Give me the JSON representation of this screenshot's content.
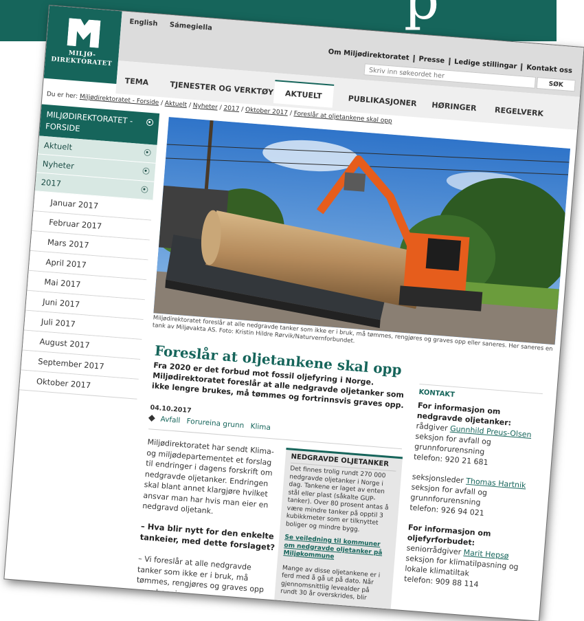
{
  "logo": {
    "line1": "MILJØ-",
    "line2": "DIREKTORATET"
  },
  "lang": {
    "english": "English",
    "sami": "Sámegiella"
  },
  "toplinks": [
    "Om Miljødirektoratet",
    "Presse",
    "Ledige stillingar",
    "Kontakt oss"
  ],
  "search": {
    "placeholder": "Skriv inn søkeordet her",
    "button": "SØK"
  },
  "nav": [
    "TEMA",
    "TJENESTER OG VERKTØY",
    "AKTUELT",
    "PUBLIKASJONER",
    "HØRINGER",
    "REGELVERK"
  ],
  "breadcrumb": {
    "prefix": "Du er her:",
    "items": [
      "Miljødirektoratet - Forside",
      "Aktuelt",
      "Nyheter",
      "2017",
      "Oktober 2017",
      "Foreslår at oljetankene skal opp"
    ]
  },
  "sidebar": {
    "home": "MILJØDIREKTORATET - FORSIDE",
    "sections": [
      "Aktuelt",
      "Nyheter",
      "2017"
    ],
    "months": [
      "Januar 2017",
      "Februar 2017",
      "Mars 2017",
      "April 2017",
      "Mai 2017",
      "Juni 2017",
      "Juli 2017",
      "August 2017",
      "September 2017",
      "Oktober 2017"
    ]
  },
  "image": {
    "caption": "Miljødirektoratet foreslår at alle nedgravde tanker som ikke er i bruk, må tømmes, rengjøres og graves opp eller saneres. Her saneres en tank av Miljøvakta AS. Foto: Kristin Hildre Rørvik/Naturvernforbundet."
  },
  "article": {
    "title": "Foreslår at oljetankene skal opp",
    "lead": "Fra 2020 er det forbud mot fossil oljefyring i Norge. Miljødirektoratet foreslår at alle nedgravde oljetanker som ikke lengre brukes, må tømmes og fortrinnsvis graves opp.",
    "date": "04.10.2017",
    "tags": [
      "Avfall",
      "Forureina grunn",
      "Klima"
    ],
    "body1": "Miljødirektoratet har sendt Klima- og miljødepartementet et forslag til endringer i dagens forskrift om nedgravde oljetanker. Endringen skal blant annet klargjøre hvilket ansvar man har hvis man eier en nedgravd oljetank.",
    "subhead": "– Hva blir nytt for den enkelte tankeier, med dette forslaget?",
    "body2": "– Vi foreslår at alle nedgravde tanker som ikke er i bruk, må tømmes, rengjøres og graves opp – uavhengig"
  },
  "factbox": {
    "title": "NEDGRAVDE OLJETANKER",
    "text": "Det finnes trolig rundt 270 000 nedgravde oljetanker i Norge i dag. Tankene er laget av enten stål eller plast (såkalte GUP-tanker). Over 80 prosent antas å være mindre tanker på opptil 3 kubikkmeter som er tilknyttet boliger og mindre bygg.",
    "link": "Se veiledning til kommuner om nedgravde oljetanker på Miljøkommune",
    "text2": "Mange av disse oljetankene er i ferd med å gå ut på dato. Når gjennomsnittlig levealder på rundt 30 år overskrides, blir"
  },
  "contact": {
    "title": "KONTAKT",
    "blocks": [
      {
        "head": "For informasjon om nedgravde oljetanker:",
        "role": "rådgiver",
        "name": "Gunnhild Preus-Olsen",
        "dept": "seksjon for avfall og grunnforurensning",
        "phone": "telefon: 920 21 681"
      },
      {
        "head": "",
        "role": "seksjonsleder",
        "name": "Thomas Hartnik",
        "dept": "seksjon for avfall og grunnforurensning",
        "phone": "telefon: 926 94 021"
      },
      {
        "head": "For informasjon om oljefyrforbudet:",
        "role": "seniorrådgiver",
        "name": "Marit Hepsø",
        "dept": "seksjon for klimatilpasning og lokale klimatiltak",
        "phone": "telefon: 909 88 114"
      }
    ]
  },
  "colors": {
    "brand": "#16655b",
    "sidebar_section": "#d8e8e3"
  }
}
